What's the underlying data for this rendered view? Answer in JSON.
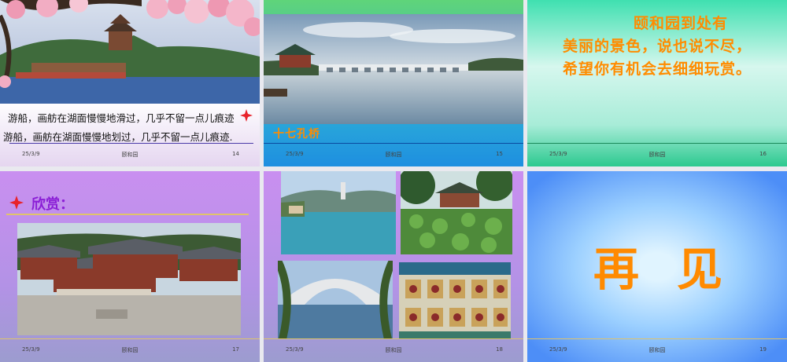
{
  "slides": [
    {
      "number": "14",
      "date": "25/3/9",
      "title": "颐和园",
      "caption_line1": "游船，画舫在湖面慢慢地滑过，几乎不留一点儿痕迹",
      "caption_line2": "游船，画舫在湖面慢慢地划过，几乎不留一点儿痕迹."
    },
    {
      "number": "15",
      "date": "25/3/9",
      "title": "颐和园",
      "photo_label": "十七孔桥"
    },
    {
      "number": "16",
      "date": "25/3/9",
      "title": "颐和园",
      "poem": [
        "颐和园到处有",
        "美丽的景色，说也说不尽，",
        "希望你有机会去细细玩赏。"
      ]
    },
    {
      "number": "17",
      "date": "25/3/9",
      "title": "颐和园",
      "heading": "欣赏："
    },
    {
      "number": "18",
      "date": "25/3/9",
      "title": "颐和园"
    },
    {
      "number": "19",
      "date": "25/3/9",
      "title": "颐和园",
      "farewell": [
        "再",
        "见"
      ]
    }
  ],
  "colors": {
    "star": "#e8232a",
    "poem_text": "#ff8c00",
    "heading_text": "#8b1fd6",
    "label_text": "#ff8c00",
    "slide2_label_bg": "#1ea0ff"
  },
  "icons": {
    "caption_star": "four-point-star-icon",
    "heading_star": "four-point-star-icon"
  }
}
